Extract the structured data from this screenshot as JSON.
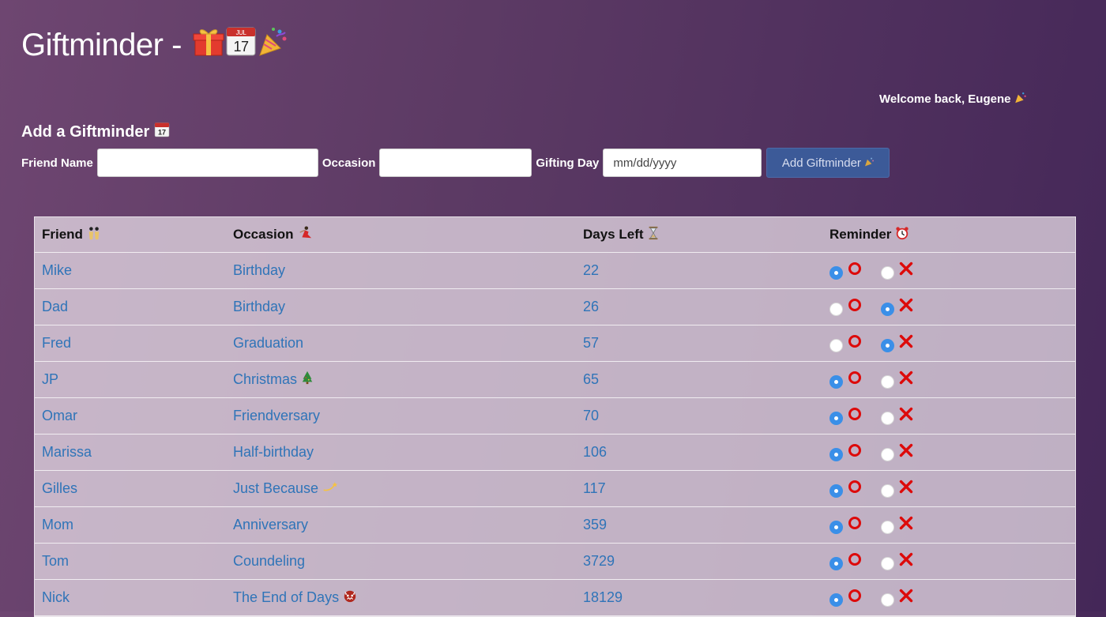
{
  "app": {
    "title": "Giftminder -",
    "welcome": "Welcome back, Eugene"
  },
  "form": {
    "heading": "Add a Giftminder",
    "friend_label": "Friend Name",
    "friend_value": "",
    "occasion_label": "Occasion",
    "occasion_value": "",
    "day_label": "Gifting Day",
    "day_placeholder": "mm/dd/yyyy",
    "submit_label": "Add Giftminder"
  },
  "table": {
    "headers": {
      "friend": "Friend",
      "occasion": "Occasion",
      "days_left": "Days Left",
      "reminder": "Reminder"
    },
    "rows": [
      {
        "friend": "Mike",
        "occasion": "Birthday",
        "occasion_icon": "",
        "days_left": "22",
        "reminder": "on"
      },
      {
        "friend": "Dad",
        "occasion": "Birthday",
        "occasion_icon": "",
        "days_left": "26",
        "reminder": "off"
      },
      {
        "friend": "Fred",
        "occasion": "Graduation",
        "occasion_icon": "",
        "days_left": "57",
        "reminder": "off"
      },
      {
        "friend": "JP",
        "occasion": "Christmas",
        "occasion_icon": "christmas-tree-icon",
        "days_left": "65",
        "reminder": "on"
      },
      {
        "friend": "Omar",
        "occasion": "Friendversary",
        "occasion_icon": "",
        "days_left": "70",
        "reminder": "on"
      },
      {
        "friend": "Marissa",
        "occasion": "Half-birthday",
        "occasion_icon": "",
        "days_left": "106",
        "reminder": "on"
      },
      {
        "friend": "Gilles",
        "occasion": "Just Because",
        "occasion_icon": "dizzy-icon",
        "days_left": "117",
        "reminder": "on"
      },
      {
        "friend": "Mom",
        "occasion": "Anniversary",
        "occasion_icon": "",
        "days_left": "359",
        "reminder": "on"
      },
      {
        "friend": "Tom",
        "occasion": "Coundeling",
        "occasion_icon": "",
        "days_left": "3729",
        "reminder": "on"
      },
      {
        "friend": "Nick",
        "occasion": "The End of Days",
        "occasion_icon": "demon-icon",
        "days_left": "18129",
        "reminder": "on"
      }
    ]
  },
  "icons": {
    "title": [
      "gift-icon",
      "calendar-icon",
      "party-popper-icon"
    ],
    "welcome": "party-popper-icon",
    "add_heading": "calendar-icon",
    "submit": "party-popper-icon",
    "header_friend": "dancers-icon",
    "header_occasion": "dancer-icon",
    "header_days_left": "hourglass-icon",
    "header_reminder": "alarm-clock-icon",
    "reminder_on": "red-circle-icon",
    "reminder_off": "red-x-icon"
  },
  "colors": {
    "link": "#2f74b8",
    "button": "#3c5a98",
    "radio_selected": "#3a8fe8",
    "mark": "#dd0a0a"
  }
}
